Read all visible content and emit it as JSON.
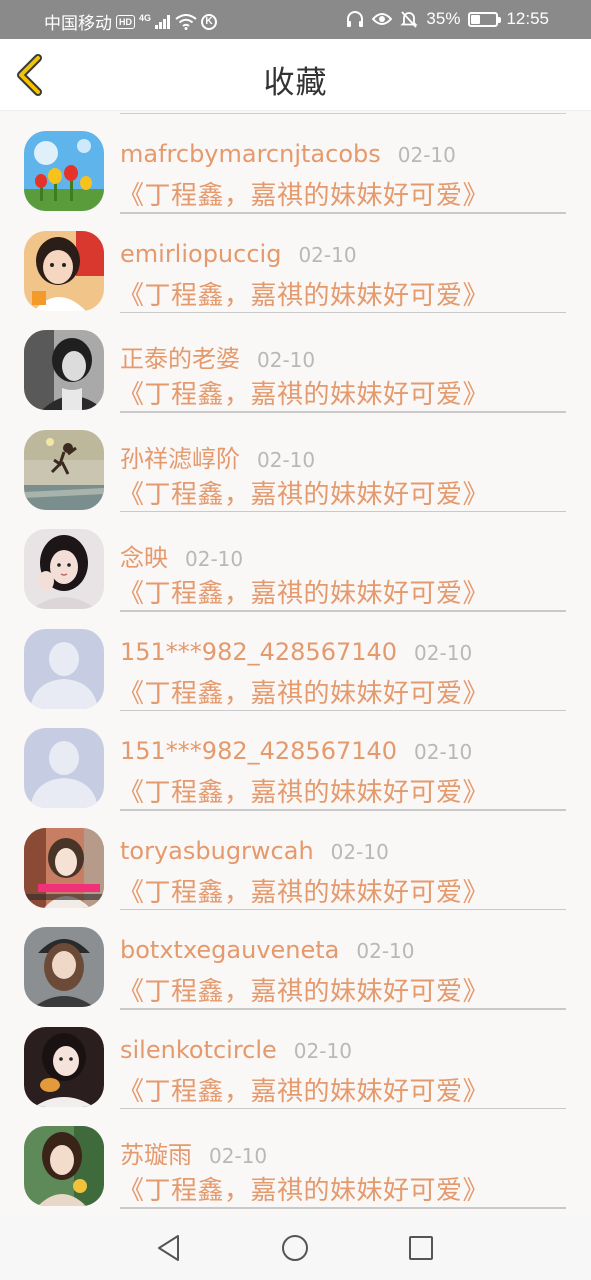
{
  "status_bar": {
    "carrier": "中国移动",
    "hd_badge": "HD",
    "network": "4G",
    "vpn_badge": "K",
    "battery_percent": "35%",
    "battery_level": 0.35,
    "time": "12:55",
    "icons": [
      "headphones-icon",
      "eye-icon",
      "mute-bell-icon",
      "battery-icon",
      "wifi-icon",
      "signal-icon"
    ]
  },
  "header": {
    "title": "收藏",
    "back_icon": "chevron-left-icon",
    "accent_color": "#f5c400"
  },
  "colors": {
    "name_text": "#e49a6c",
    "date_text": "#b8b8b8",
    "background": "#faf7f7"
  },
  "list": {
    "items": [
      {
        "name": "mafrcbymarcnjtacobs",
        "date": "02-10",
        "message": "《丁程鑫，嘉祺的妹妹好可爱》",
        "avatar": "tulips-photo"
      },
      {
        "name": "emirliopuccig",
        "date": "02-10",
        "message": "《丁程鑫，嘉祺的妹妹好可爱》",
        "avatar": "child-photo"
      },
      {
        "name": "正泰的老婆",
        "date": "02-10",
        "message": "《丁程鑫，嘉祺的妹妹好可爱》",
        "avatar": "girl-bw-photo"
      },
      {
        "name": "孙祥滤崞阶",
        "date": "02-10",
        "message": "《丁程鑫，嘉祺的妹妹好可爱》",
        "avatar": "jump-beach-photo"
      },
      {
        "name": "念映",
        "date": "02-10",
        "message": "《丁程鑫，嘉祺的妹妹好可爱》",
        "avatar": "girl-portrait-photo"
      },
      {
        "name": "151***982_428567140",
        "date": "02-10",
        "message": "《丁程鑫，嘉祺的妹妹好可爱》",
        "avatar": "default-avatar"
      },
      {
        "name": "151***982_428567140",
        "date": "02-10",
        "message": "《丁程鑫，嘉祺的妹妹好可爱》",
        "avatar": "default-avatar"
      },
      {
        "name": "toryasbugrwcah",
        "date": "02-10",
        "message": "《丁程鑫，嘉祺的妹妹好可爱》",
        "avatar": "woman-street-photo"
      },
      {
        "name": "botxtxegauveneta",
        "date": "02-10",
        "message": "《丁程鑫，嘉祺的妹妹好可爱》",
        "avatar": "woman-cap-photo"
      },
      {
        "name": "silenkotcircle",
        "date": "02-10",
        "message": "《丁程鑫，嘉祺的妹妹好可爱》",
        "avatar": "girl-eating-photo"
      },
      {
        "name": "苏璇雨",
        "date": "02-10",
        "message": "《丁程鑫，嘉祺的妹妹好可爱》",
        "avatar": "girl-flower-photo"
      }
    ]
  },
  "nav_bar": {
    "back_icon": "triangle-back-icon",
    "home_icon": "circle-home-icon",
    "recents_icon": "square-recents-icon"
  }
}
